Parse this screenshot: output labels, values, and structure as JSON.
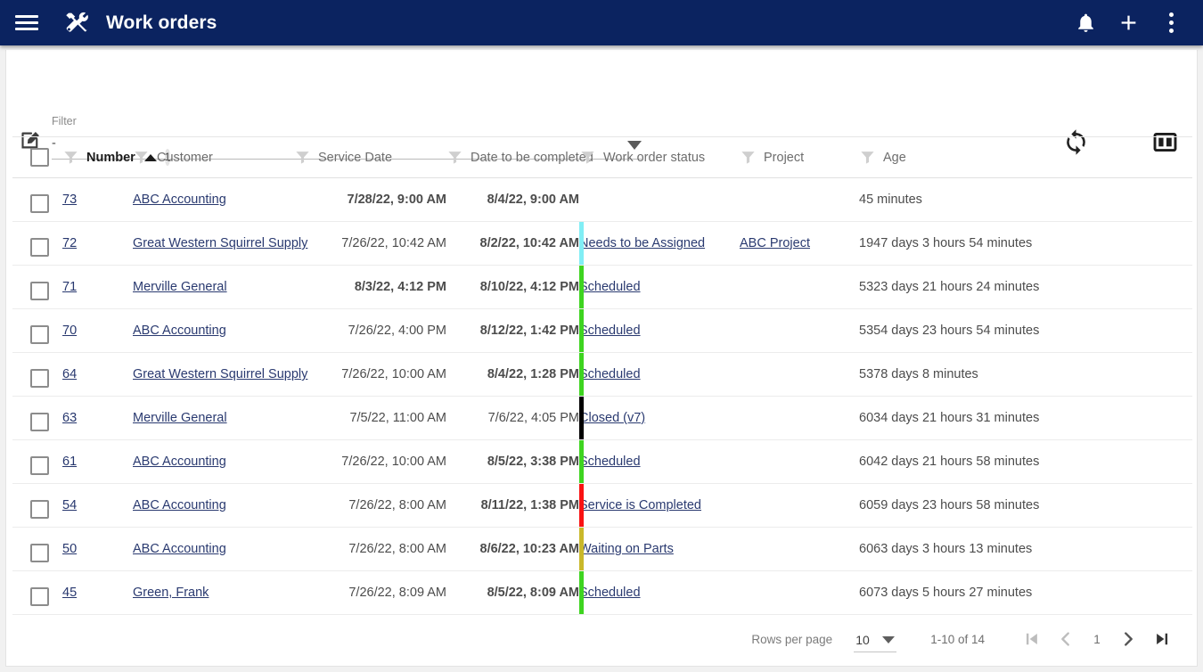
{
  "appbar": {
    "menu_icon": "hamburger-menu-icon",
    "app_icon": "tools-wrench-screwdriver-icon",
    "title": "Work orders",
    "actions": [
      {
        "name": "notifications-bell-icon",
        "label": "Notifications"
      },
      {
        "name": "add-plus-icon",
        "label": "Add"
      },
      {
        "name": "overflow-menu-icon",
        "label": "More options"
      }
    ],
    "bg_color": "#0b2360"
  },
  "toolbar": {
    "edit_icon": "edit-pencil-square-icon",
    "filter_label": "Filter",
    "filter_value": "-",
    "filter_placeholder": "-",
    "refresh_icon": "refresh-sync-icon",
    "columns_icon": "column-layout-icon"
  },
  "table": {
    "select_all_label": "Select all rows",
    "columns": [
      {
        "key": "number",
        "label": "Number",
        "sorted": true,
        "sort_direction": "asc",
        "sort_badge": "1"
      },
      {
        "key": "customer",
        "label": "Customer"
      },
      {
        "key": "service_date",
        "label": "Service Date"
      },
      {
        "key": "date_to_be_completed",
        "label": "Date to be completed"
      },
      {
        "key": "work_order_status",
        "label": "Work order status"
      },
      {
        "key": "project",
        "label": "Project"
      },
      {
        "key": "age",
        "label": "Age"
      }
    ],
    "rows": [
      {
        "number": "73",
        "customer": "ABC Accounting",
        "service_date": "7/28/22, 9:00 AM",
        "service_date_bold": true,
        "date_to_be_completed": "8/4/22, 9:00 AM",
        "date_bold": true,
        "status": "",
        "status_color": "",
        "project": "",
        "age": "45 minutes"
      },
      {
        "number": "72",
        "customer": "Great Western Squirrel Supply",
        "service_date": "7/26/22, 10:42 AM",
        "service_date_bold": false,
        "date_to_be_completed": "8/2/22, 10:42 AM",
        "date_bold": true,
        "status": "Needs to be Assigned",
        "status_color": "#81eef5",
        "project": "ABC Project",
        "age": "1947 days 3 hours 54 minutes"
      },
      {
        "number": "71",
        "customer": "Merville General",
        "service_date": "8/3/22, 4:12 PM",
        "service_date_bold": true,
        "date_to_be_completed": "8/10/22, 4:12 PM",
        "date_bold": true,
        "status": "Scheduled",
        "status_color": "#3ed420",
        "project": "",
        "age": "5323 days 21 hours 24 minutes"
      },
      {
        "number": "70",
        "customer": "ABC Accounting",
        "service_date": "7/26/22, 4:00 PM",
        "service_date_bold": false,
        "date_to_be_completed": "8/12/22, 1:42 PM",
        "date_bold": true,
        "status": "Scheduled",
        "status_color": "#3ed420",
        "project": "",
        "age": "5354 days 23 hours 54 minutes"
      },
      {
        "number": "64",
        "customer": "Great Western Squirrel Supply",
        "service_date": "7/26/22, 10:00 AM",
        "service_date_bold": false,
        "date_to_be_completed": "8/4/22, 1:28 PM",
        "date_bold": true,
        "status": "Scheduled",
        "status_color": "#3ed420",
        "project": "",
        "age": "5378 days 8 minutes"
      },
      {
        "number": "63",
        "customer": "Merville General",
        "service_date": "7/5/22, 11:00 AM",
        "service_date_bold": false,
        "date_to_be_completed": "7/6/22, 4:05 PM",
        "date_bold": false,
        "status": "Closed (v7)",
        "status_color": "#000000",
        "project": "",
        "age": "6034 days 21 hours 31 minutes"
      },
      {
        "number": "61",
        "customer": "ABC Accounting",
        "service_date": "7/26/22, 10:00 AM",
        "service_date_bold": false,
        "date_to_be_completed": "8/5/22, 3:38 PM",
        "date_bold": true,
        "status": "Scheduled",
        "status_color": "#3ed420",
        "project": "",
        "age": "6042 days 21 hours 58 minutes"
      },
      {
        "number": "54",
        "customer": "ABC Accounting",
        "service_date": "7/26/22, 8:00 AM",
        "service_date_bold": false,
        "date_to_be_completed": "8/11/22, 1:38 PM",
        "date_bold": true,
        "status": "Service is Completed",
        "status_color": "#f91212",
        "project": "",
        "age": "6059 days 23 hours 58 minutes"
      },
      {
        "number": "50",
        "customer": "ABC Accounting",
        "service_date": "7/26/22, 8:00 AM",
        "service_date_bold": false,
        "date_to_be_completed": "8/6/22, 10:23 AM",
        "date_bold": true,
        "status": "Waiting on Parts",
        "status_color": "#c9b82a",
        "project": "",
        "age": "6063 days 3 hours 13 minutes"
      },
      {
        "number": "45",
        "customer": "Green, Frank",
        "service_date": "7/26/22, 8:09 AM",
        "service_date_bold": false,
        "date_to_be_completed": "8/5/22, 8:09 AM",
        "date_bold": true,
        "status": "Scheduled",
        "status_color": "#3ed420",
        "project": "",
        "age": "6073 days 5 hours 27 minutes"
      }
    ]
  },
  "paginator": {
    "rows_per_page_label": "Rows per page",
    "rows_per_page_value": "10",
    "range_label": "1-10 of 14",
    "current_page": "1",
    "first_page_icon": "first-page-icon",
    "prev_page_icon": "previous-page-icon",
    "next_page_icon": "next-page-icon",
    "last_page_icon": "last-page-icon"
  }
}
